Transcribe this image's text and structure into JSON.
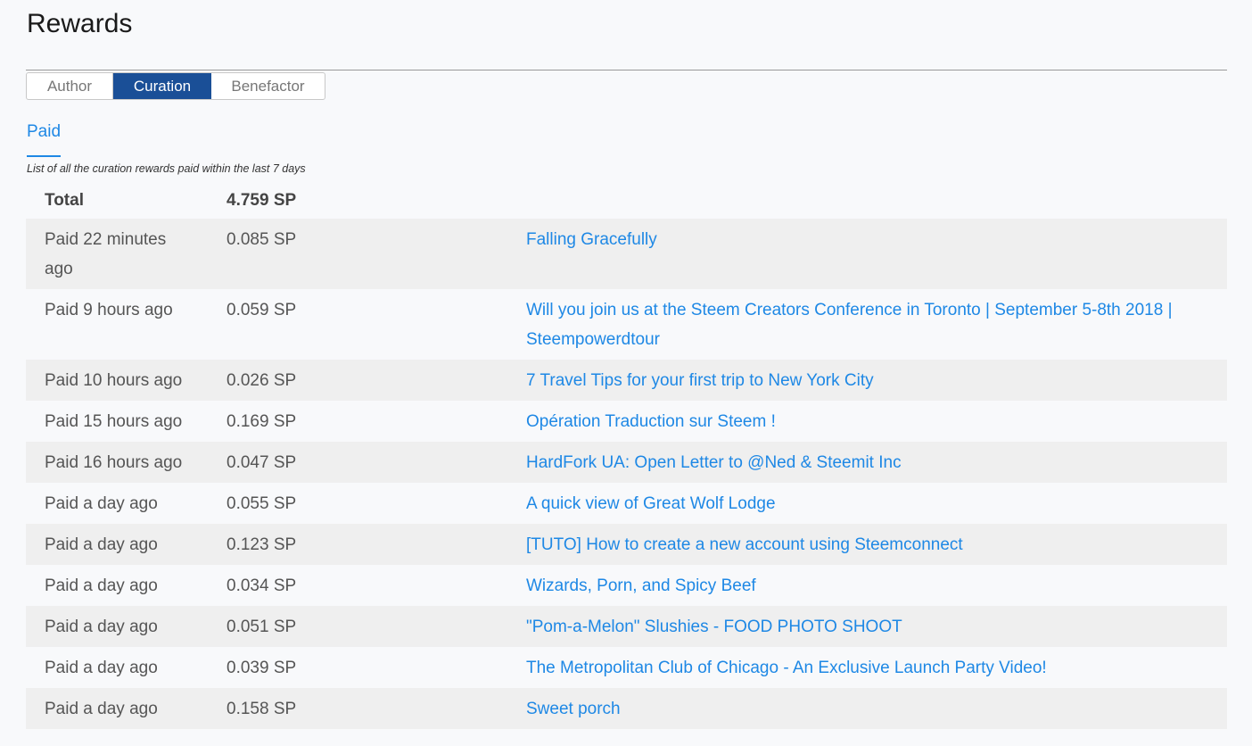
{
  "page": {
    "title": "Rewards",
    "tabs": [
      {
        "label": "Author",
        "active": false
      },
      {
        "label": "Curation",
        "active": true
      },
      {
        "label": "Benefactor",
        "active": false
      }
    ],
    "subnav": {
      "label": "Paid"
    },
    "caption": "List of all the curation rewards paid within the last 7 days"
  },
  "total": {
    "label": "Total",
    "amount": "4.759 SP"
  },
  "rows": [
    {
      "when": "Paid 22 minutes ago",
      "amount": "0.085 SP",
      "post": "Falling Gracefully"
    },
    {
      "when": "Paid 9 hours ago",
      "amount": "0.059 SP",
      "post": "Will you join us at the Steem Creators Conference in Toronto | September 5-8th 2018 | Steempowerdtour"
    },
    {
      "when": "Paid 10 hours ago",
      "amount": "0.026 SP",
      "post": "7 Travel Tips for your first trip to New York City"
    },
    {
      "when": "Paid 15 hours ago",
      "amount": "0.169 SP",
      "post": "Opération Traduction sur Steem !"
    },
    {
      "when": "Paid 16 hours ago",
      "amount": "0.047 SP",
      "post": "HardFork UA: Open Letter to @Ned & Steemit Inc"
    },
    {
      "when": "Paid a day ago",
      "amount": "0.055 SP",
      "post": "A quick view of Great Wolf Lodge"
    },
    {
      "when": "Paid a day ago",
      "amount": "0.123 SP",
      "post": "[TUTO] How to create a new account using Steemconnect"
    },
    {
      "when": "Paid a day ago",
      "amount": "0.034 SP",
      "post": "Wizards, Porn, and Spicy Beef"
    },
    {
      "when": "Paid a day ago",
      "amount": "0.051 SP",
      "post": "\"Pom-a-Melon\" Slushies - FOOD PHOTO SHOOT"
    },
    {
      "when": "Paid a day ago",
      "amount": "0.039 SP",
      "post": "The Metropolitan Club of Chicago - An Exclusive Launch Party Video!"
    },
    {
      "when": "Paid a day ago",
      "amount": "0.158 SP",
      "post": "Sweet porch"
    }
  ],
  "colors": {
    "accent": "#1e88e5",
    "active_tab": "#1a4f97",
    "row_stripe": "#efefef",
    "background": "#f8f9fb"
  }
}
